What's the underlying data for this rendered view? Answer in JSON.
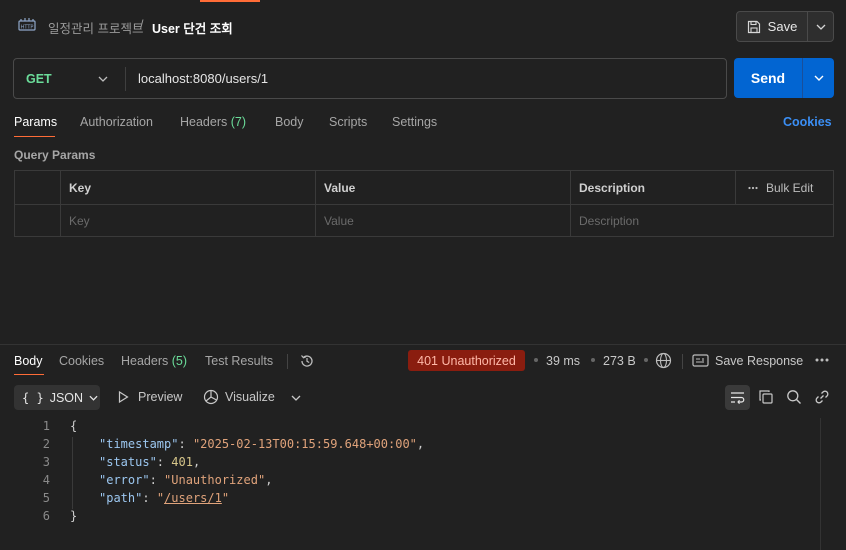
{
  "header": {
    "breadcrumb_parent": "일정관리 프로젝트",
    "breadcrumb_sep": "/",
    "breadcrumb_current": "User 단건 조회",
    "save_label": "Save"
  },
  "request": {
    "method": "GET",
    "url": "localhost:8080/users/1",
    "send_label": "Send"
  },
  "request_tabs": {
    "params": "Params",
    "authorization": "Authorization",
    "headers": "Headers",
    "headers_count": "(7)",
    "body": "Body",
    "scripts": "Scripts",
    "settings": "Settings",
    "cookies": "Cookies"
  },
  "query_params": {
    "title": "Query Params",
    "columns": [
      "Key",
      "Value",
      "Description"
    ],
    "bulk_edit": "Bulk Edit",
    "placeholders": [
      "Key",
      "Value",
      "Description"
    ]
  },
  "response_tabs": {
    "body": "Body",
    "cookies": "Cookies",
    "headers": "Headers",
    "headers_count": "(5)",
    "test_results": "Test Results"
  },
  "response_meta": {
    "status": "401 Unauthorized",
    "time": "39 ms",
    "size": "273 B",
    "save_response": "Save Response"
  },
  "format_bar": {
    "format": "JSON",
    "preview": "Preview",
    "visualize": "Visualize"
  },
  "code": {
    "line_numbers": [
      "1",
      "2",
      "3",
      "4",
      "5",
      "6"
    ],
    "open": "{",
    "close": "}",
    "k_timestamp": "\"timestamp\"",
    "v_timestamp": "\"2025-02-13T00:15:59.648+00:00\"",
    "k_status": "\"status\"",
    "v_status": "401",
    "k_error": "\"error\"",
    "v_error": "\"Unauthorized\"",
    "k_path": "\"path\"",
    "v_path": "/users/1"
  },
  "colors": {
    "accent": "#ff6c37",
    "send": "#0265d2",
    "method_get": "#6bdd9a",
    "error_badge": "#8a1d0f"
  }
}
